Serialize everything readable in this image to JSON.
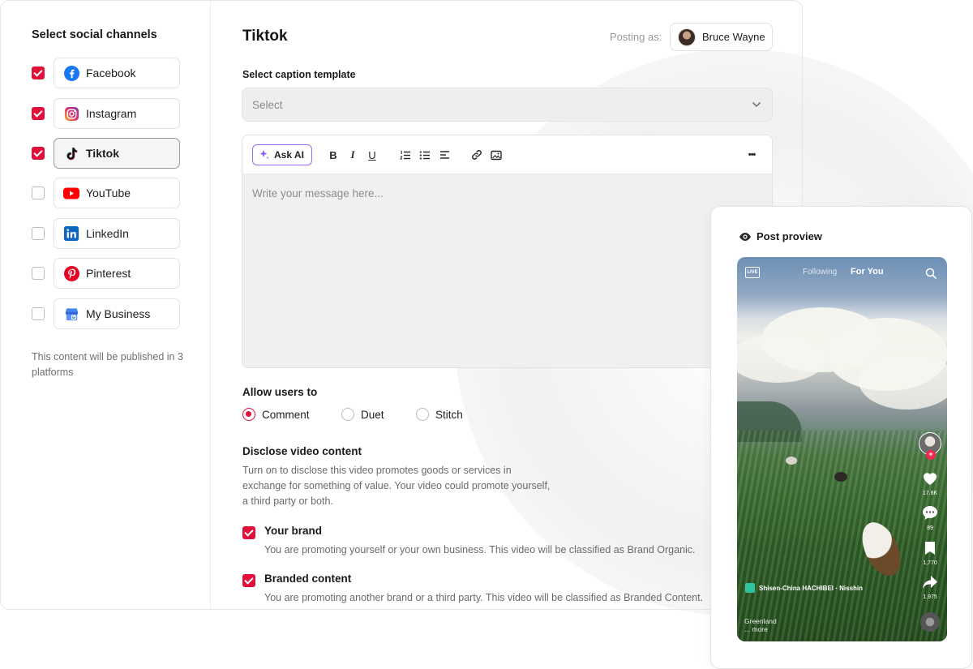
{
  "sidebar": {
    "title": "Select social channels",
    "channels": [
      {
        "label": "Facebook",
        "checked": true,
        "icon": "facebook-icon"
      },
      {
        "label": "Instagram",
        "checked": true,
        "icon": "instagram-icon"
      },
      {
        "label": "Tiktok",
        "checked": true,
        "icon": "tiktok-icon",
        "active": true
      },
      {
        "label": "YouTube",
        "checked": false,
        "icon": "youtube-icon"
      },
      {
        "label": "LinkedIn",
        "checked": false,
        "icon": "linkedin-icon"
      },
      {
        "label": "Pinterest",
        "checked": false,
        "icon": "pinterest-icon"
      },
      {
        "label": "My Business",
        "checked": false,
        "icon": "google-business-icon"
      }
    ],
    "note": "This content will be published in 3 platforms"
  },
  "header": {
    "title": "Tiktok",
    "posting_label": "Posting as:",
    "user_name": "Bruce Wayne"
  },
  "caption_template": {
    "label": "Select caption template",
    "placeholder": "Select"
  },
  "editor": {
    "ask_ai_label": "Ask AI",
    "bold": "B",
    "italic": "I",
    "underline": "U",
    "more": "•••",
    "placeholder": "Write your message here..."
  },
  "allow_users": {
    "label": "Allow users to",
    "options": [
      {
        "label": "Comment",
        "selected": true
      },
      {
        "label": "Duet",
        "selected": false
      },
      {
        "label": "Stitch",
        "selected": false
      }
    ]
  },
  "disclose": {
    "label": "Disclose video content",
    "description": "Turn on to disclose this video promotes goods or services in exchange for something of value. Your video could promote yourself, a third party or both.",
    "items": [
      {
        "title": "Your brand",
        "checked": true,
        "text": "You are promoting yourself or your own business. This video will be classified as Brand Organic."
      },
      {
        "title": "Branded content",
        "checked": true,
        "text": "You are promoting another brand or a third party. This video will be classified as Branded Content."
      }
    ]
  },
  "preview": {
    "title": "Post proview",
    "tab_following": "Following",
    "tab_for_you": "For You",
    "live_label": "LIVE",
    "likes": "17.8K",
    "comments": "89",
    "saves": "1,770",
    "shares": "1,975",
    "place": "Shisen-China HACHIBEI · Nisshin",
    "caption_line1": "Greenland",
    "caption_line2": "... more"
  },
  "colors": {
    "accent": "#e0103a",
    "ai_border": "#9b6cf4"
  }
}
